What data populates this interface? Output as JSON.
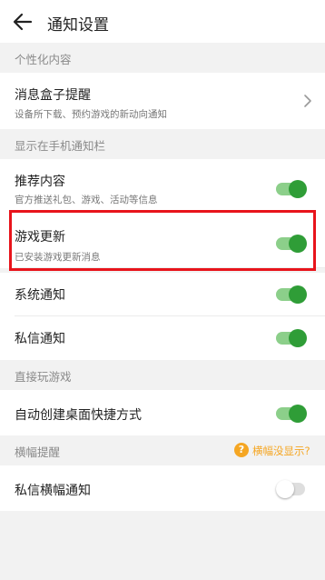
{
  "header": {
    "title": "通知设置",
    "back_icon": "arrow-left-icon"
  },
  "sections": {
    "personal": "个性化内容",
    "notification_bar": "显示在手机通知栏",
    "play": "直接玩游戏",
    "banner": "横幅提醒"
  },
  "items": {
    "inbox": {
      "label": "消息盒子提醒",
      "sub": "设备所下载、预约游戏的新动向通知",
      "icon": "chevron-right-icon"
    },
    "recommend": {
      "label": "推荐内容",
      "sub": "官方推送礼包、游戏、活动等信息",
      "on": true
    },
    "game_update": {
      "label": "游戏更新",
      "sub": "已安装游戏更新消息",
      "on": true
    },
    "system": {
      "label": "系统通知",
      "on": true
    },
    "private": {
      "label": "私信通知",
      "on": true
    },
    "shortcut": {
      "label": "自动创建桌面快捷方式",
      "on": true
    },
    "private_banner": {
      "label": "私信横幅通知",
      "on": false
    }
  },
  "banner_help": {
    "icon": "question-circle-icon",
    "symbol": "?",
    "text": "横幅没显示?"
  },
  "colors": {
    "toggle_on": "#2f9d37",
    "toggle_track_on": "#8ccf8a",
    "highlight": "#e8141b",
    "help": "#f5a623"
  }
}
